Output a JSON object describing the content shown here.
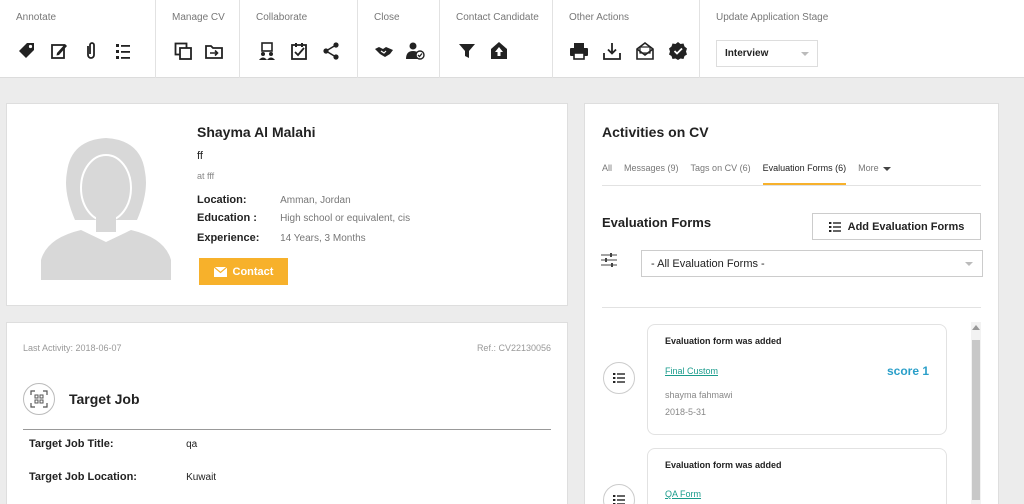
{
  "toolbar": {
    "groups": [
      {
        "title": "Annotate",
        "icons": [
          "tag-icon",
          "edit-icon",
          "attachment-icon",
          "list-icon"
        ]
      },
      {
        "title": "Manage CV",
        "icons": [
          "copy-icon",
          "move-icon"
        ]
      },
      {
        "title": "Collaborate",
        "icons": [
          "users-icon",
          "checkbox-icon",
          "share-icon"
        ]
      },
      {
        "title": "Close",
        "icons": [
          "handshake-icon",
          "user-check-icon"
        ]
      },
      {
        "title": "Contact Candidate",
        "icons": [
          "filter-icon",
          "upload-icon"
        ]
      },
      {
        "title": "Other Actions",
        "icons": [
          "print-icon",
          "download-icon",
          "mail-icon",
          "verified-icon"
        ]
      },
      {
        "title": "Update Application Stage"
      }
    ],
    "stage_value": "Interview"
  },
  "profile": {
    "name": "Shayma Al Malahi",
    "headline": "ff",
    "at": "at fff",
    "location_label": "Location:",
    "location": "Amman, Jordan",
    "education_label": "Education :",
    "education": "High school or equivalent, cis",
    "experience_label": "Experience:",
    "experience": "14 Years, 3 Months",
    "contact_label": "Contact"
  },
  "target": {
    "last_activity": "Last Activity: 2018-06-07",
    "ref": "Ref.: CV22130056",
    "title": "Target Job",
    "job_title_label": "Target Job Title:",
    "job_title": "qa",
    "job_location_label": "Target Job Location:",
    "job_location": "Kuwait"
  },
  "activities": {
    "title": "Activities on CV",
    "tabs": [
      "All",
      "Messages (9)",
      "Tags on CV (6)",
      "Evaluation Forms (6)",
      "More"
    ],
    "section_title": "Evaluation Forms",
    "add_label": "Add Evaluation Forms",
    "filter_value": "- All Evaluation Forms -",
    "items": [
      {
        "head": "Evaluation form was added",
        "link": "Final Custom",
        "score": "score 1",
        "user": "shayma fahmawi",
        "date": "2018-5-31"
      },
      {
        "head": "Evaluation form was added",
        "link": "QA Form"
      }
    ]
  }
}
